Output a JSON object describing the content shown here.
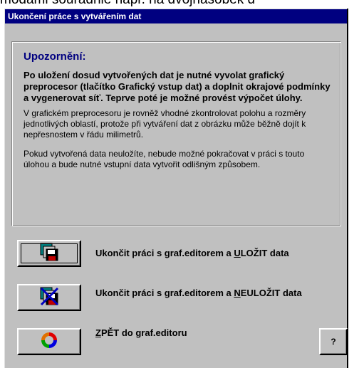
{
  "background": {
    "text": "modami souradnie napr. na dvojnasobek d"
  },
  "dialog": {
    "title": "Ukončení práce s vytvářením dat",
    "warning": {
      "heading": "Upozornění:",
      "bold_text": "Po uložení dosud vytvořených dat je nutné vyvolat grafický preprocesor (tlačítko Grafický vstup dat) a doplnit okrajové podmínky a vygenerovat síť. Teprve poté je možné provést výpočet úlohy.",
      "paragraph1": "V grafickém preprocesoru je rovněž vhodné zkontrolovat polohu a rozměry jednotlivých oblastí, protože při vytváření dat z obrázku může běžně dojít k nepřesnostem v řádu milimetrů.",
      "paragraph2": "Pokud vytvořená data neuložíte, nebude možné pokračovat v práci s touto úlohou a bude nutné vstupní data vytvořit odlišným způsobem."
    },
    "actions": {
      "save": {
        "label_before": "Ukončit práci s graf.editorem a ",
        "label_underlined": "U",
        "label_after": "LOŽIT data",
        "icon": "save-floppy-icon"
      },
      "nosave": {
        "label_before": "Ukončit práci s graf.editorem a ",
        "label_underlined": "N",
        "label_after": "EULOŽIT data",
        "icon": "discard-floppy-icon"
      },
      "back": {
        "label_underlined": "Z",
        "label_after": "PĚT do graf.editoru",
        "icon": "refresh-arrows-icon"
      }
    },
    "help": {
      "label": "?"
    }
  }
}
